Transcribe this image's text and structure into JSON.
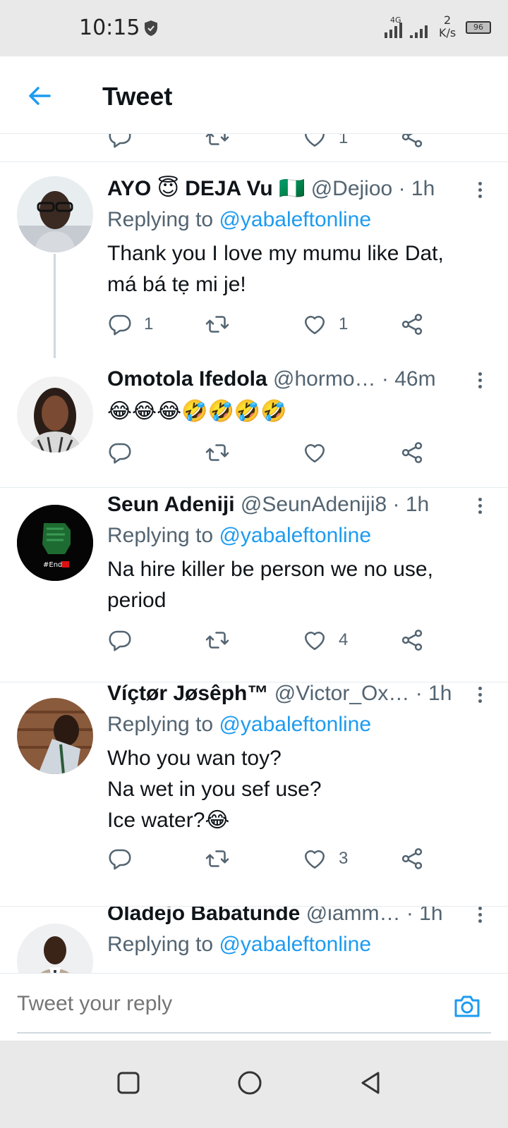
{
  "status_bar": {
    "time": "10:15",
    "network": "4G",
    "speed_value": "2",
    "speed_unit": "K/s",
    "battery": "96"
  },
  "header": {
    "title": "Tweet"
  },
  "clipped_previous": {
    "like_count": "1"
  },
  "tweets": [
    {
      "name": "AYO 😇 DEJA Vu 🇳🇬",
      "handle": "@Dejioo",
      "time": "· 1h",
      "replying_prefix": "Replying to ",
      "replying_to": "@yabaleftonline",
      "text": "Thank you I love my mumu like Dat,\nmá bá tẹ mi je!",
      "reply_count": "1",
      "retweet_count": "",
      "like_count": "1"
    },
    {
      "name": "Omotola Ifedola",
      "handle": "@hormo…",
      "time": "· 46m",
      "text": "😂😂😂🤣🤣🤣🤣",
      "reply_count": "",
      "retweet_count": "",
      "like_count": ""
    },
    {
      "name": "Seun Adeniji",
      "handle": "@SeunAdeniji8",
      "time": "· 1h",
      "replying_prefix": "Replying to ",
      "replying_to": "@yabaleftonline",
      "text": "Na hire killer be person we no use,\nperiod",
      "reply_count": "",
      "retweet_count": "",
      "like_count": "4",
      "avatar_label": "#End"
    },
    {
      "name": "Víçtør Jøsêph™",
      "handle": "@Victor_Ox…",
      "time": "· 1h",
      "replying_prefix": "Replying to ",
      "replying_to": "@yabaleftonline",
      "text": "Who you wan toy?\nNa wet in you sef  use?\nIce water?😂",
      "reply_count": "",
      "retweet_count": "",
      "like_count": "3"
    },
    {
      "name": "Oladejo Babatunde",
      "handle": "@iamm…",
      "time": "· 1h",
      "replying_prefix": "Replying to ",
      "replying_to": "@yabaleftonline"
    }
  ],
  "composer": {
    "placeholder": "Tweet your reply"
  },
  "colors": {
    "accent": "#1d9bf0",
    "secondary_text": "#536471",
    "divider": "#e6ecf0"
  }
}
